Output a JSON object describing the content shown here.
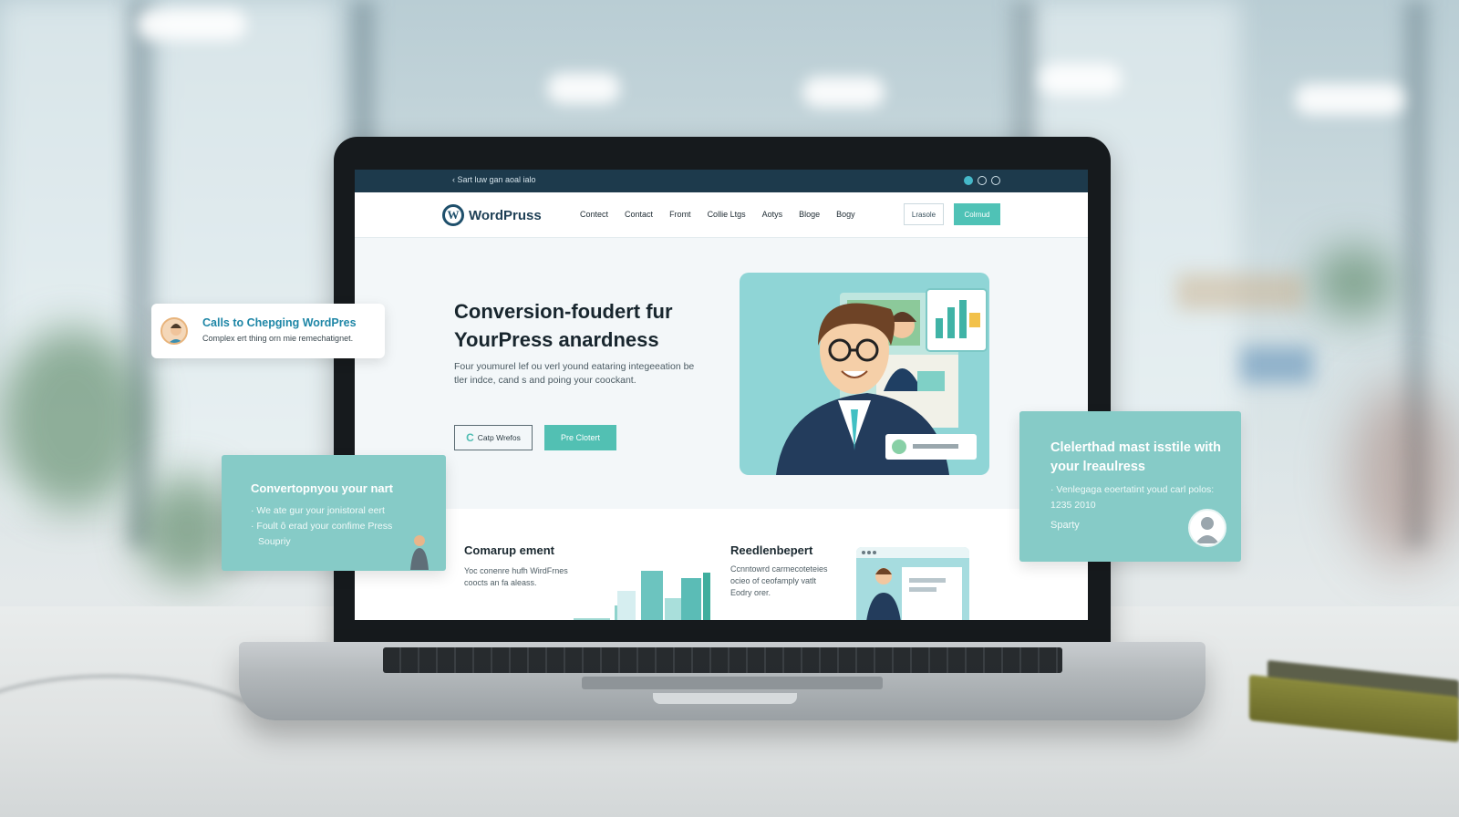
{
  "site": {
    "topbar": {
      "back_text": "Sart luw gan aoal ialo"
    },
    "logo": {
      "text": "WordPruss",
      "icon": "wordpress-logo-icon"
    },
    "nav": {
      "items": [
        "Contect",
        "Contact",
        "Fromt",
        "Collie Ltgs",
        "Aotys",
        "Bloge",
        "Bogy"
      ],
      "button_outline": "Lrasole",
      "button_primary": "Colrnud"
    },
    "hero": {
      "title": "Conversion-foudert fur YourPress anardness",
      "description": "Four youmurel lef ou verl yound eataring integeeation be tler indce, cand s and poing your coockant.",
      "button_secondary": "Catp Wrefos",
      "button_primary": "Pre Clotert"
    },
    "features": [
      {
        "title": "Comarup ement",
        "description": "Yoc conenre hufh WirdFrnes coocts an fa aleass."
      },
      {
        "title": "Reedlenbepert",
        "description": "Ccnntowrd carmecoteteies ocieo of ceofamply vatlt Eodry orer."
      }
    ]
  },
  "cards": {
    "notice": {
      "title": "Calls to Chepging WordPres",
      "subtitle": "Complex ert thing orn mie remechatignet."
    },
    "promo_left": {
      "title": "Convertopnyou your nart",
      "lines": [
        "We ate gur your jonistoral eert",
        "Foult ô erad your confime Press",
        "Soupriy"
      ]
    },
    "promo_right": {
      "title": "Clelerthad mast isstile with your lreaulress",
      "subtitle": "Venlegaga eoertatint youd carl polos: 1235 2010",
      "footer": "Sparty"
    }
  },
  "colors": {
    "accent": "#4fc2b6",
    "navy": "#1d3a4c",
    "card": "#86cbc7",
    "link": "#1e86a6"
  }
}
